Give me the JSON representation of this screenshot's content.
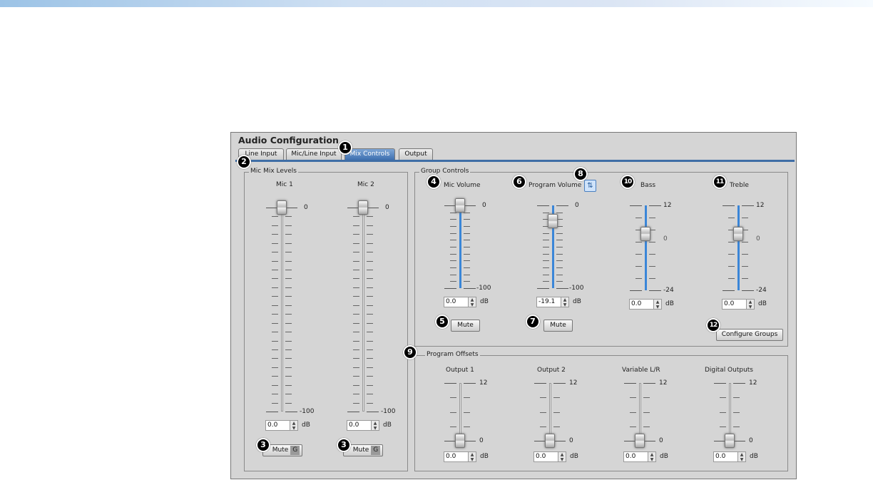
{
  "title": "Audio Configuration",
  "tabs": [
    {
      "label": "Line Input"
    },
    {
      "label": "Mic/Line Input"
    },
    {
      "label": "Mix Controls"
    },
    {
      "label": "Output"
    }
  ],
  "active_tab": "Mix Controls",
  "mic_mix": {
    "label": "Mic Mix Levels",
    "channels": [
      {
        "name": "Mic 1",
        "value": "0.0",
        "level_db": 0,
        "max_label": "0",
        "min_label": "-100",
        "mute_label": "Mute",
        "group_label": "G"
      },
      {
        "name": "Mic 2",
        "value": "0.0",
        "level_db": 0,
        "max_label": "0",
        "min_label": "-100",
        "mute_label": "Mute",
        "group_label": "G"
      }
    ]
  },
  "group_controls": {
    "label": "Group Controls",
    "mic_volume": {
      "name": "Mic Volume",
      "value": "0.0",
      "level_db": 0,
      "max_label": "0",
      "min_label": "-100",
      "mute_label": "Mute"
    },
    "program_volume": {
      "name": "Program Volume",
      "value": "-19.1",
      "level_db": -19.1,
      "max_label": "0",
      "min_label": "-100",
      "mute_label": "Mute"
    },
    "bass": {
      "name": "Bass",
      "value": "0.0",
      "level_db": 0,
      "max_label": "12",
      "mid_label": "0",
      "min_label": "-24"
    },
    "treble": {
      "name": "Treble",
      "value": "0.0",
      "level_db": 0,
      "max_label": "12",
      "mid_label": "0",
      "min_label": "-24"
    },
    "configure_label": "Configure Groups"
  },
  "program_offsets": {
    "label": "Program Offsets",
    "channels": [
      {
        "name": "Output 1",
        "value": "0.0",
        "max_label": "12",
        "min_label": "0"
      },
      {
        "name": "Output 2",
        "value": "0.0",
        "max_label": "12",
        "min_label": "0"
      },
      {
        "name": "Variable L/R",
        "value": "0.0",
        "max_label": "12",
        "min_label": "0"
      },
      {
        "name": "Digital Outputs",
        "value": "0.0",
        "max_label": "12",
        "min_label": "0"
      }
    ]
  },
  "unit": "dB",
  "callouts": [
    "1",
    "2",
    "3",
    "3",
    "4",
    "5",
    "6",
    "7",
    "8",
    "9",
    "10",
    "11",
    "12"
  ],
  "colors": {
    "accent": "#3a86d8",
    "tab_active": "#3f70b0",
    "panel": "#d5d5d5"
  }
}
